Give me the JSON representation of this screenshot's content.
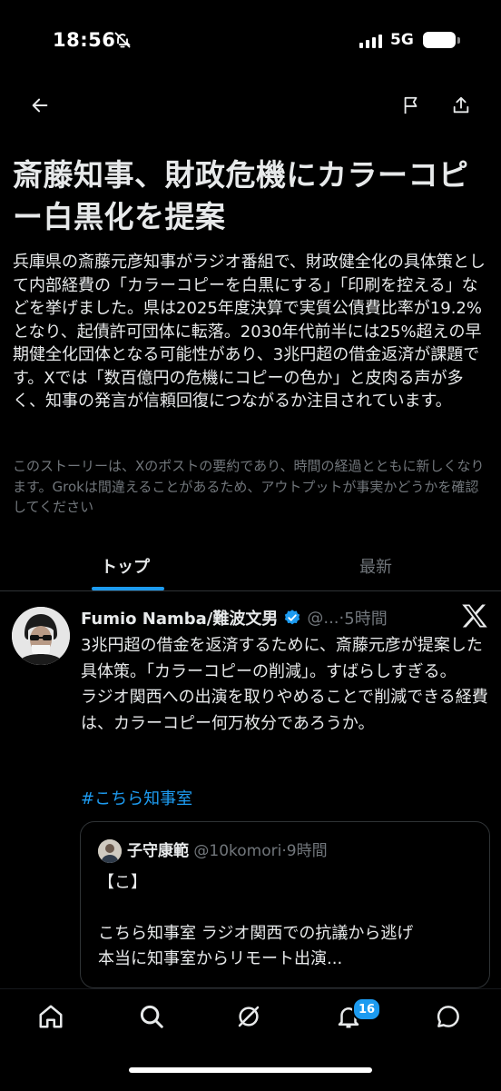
{
  "status_bar": {
    "time": "18:56",
    "network": "5G",
    "icons": [
      "bell-slash-icon",
      "signal-icon",
      "battery-icon"
    ]
  },
  "top_nav": {
    "icons": [
      "back-arrow-icon",
      "flag-icon",
      "share-icon"
    ]
  },
  "story": {
    "title": "斎藤知事、財政危機にカラーコピー白黒化を提案",
    "summary": "兵庫県の斎藤元彦知事がラジオ番組で、財政健全化の具体策として内部経費の「カラーコピーを白黒にする」「印刷を控える」などを挙げました。県は2025年度決算で実質公債費比率が19.2%となり、起債許可団体に転落。2030年代前半には25%超えの早期健全化団体となる可能性があり、3兆円超の借金返済が課題です。Xでは「数百億円の危機にコピーの色か」と皮肉る声が多く、知事の発言が信頼回復につながるか注目されています。",
    "disclaimer": "このストーリーは、Xのポストの要約であり、時間の経過とともに新しくなります。Grokは間違えることがあるため、アウトプットが事実かどうかを確認してください"
  },
  "tabs": [
    {
      "label": "トップ",
      "active": true
    },
    {
      "label": "最新",
      "active": false
    }
  ],
  "post": {
    "author": "Fumio Namba/難波文男",
    "handle": "@...",
    "separator": "·",
    "time": "5時間",
    "body": "3兆円超の借金を返済するために、斎藤元彦が提案した具体策。「カラーコピーの削減」。すばらしすぎる。\nラジオ関西への出演を取りやめることで削減できる経費は、カラーコピー何万枚分であろうか。",
    "hashtag": "#こちら知事室",
    "quote": {
      "author": "子守康範",
      "handle": "@10komori",
      "separator": "·",
      "time": "9時間",
      "body": "【こ】\n\nこちら知事室 ラジオ関西での抗議から逃げ\n本当に知事室からリモート出演..."
    }
  },
  "bottom_nav": {
    "items": [
      "home-icon",
      "search-icon",
      "grok-icon",
      "notifications-icon",
      "messages-icon"
    ],
    "notification_count": "16"
  },
  "colors": {
    "accent": "#1d9bf0",
    "background": "#000000",
    "text": "#e7e9ea",
    "muted": "#71767b"
  }
}
